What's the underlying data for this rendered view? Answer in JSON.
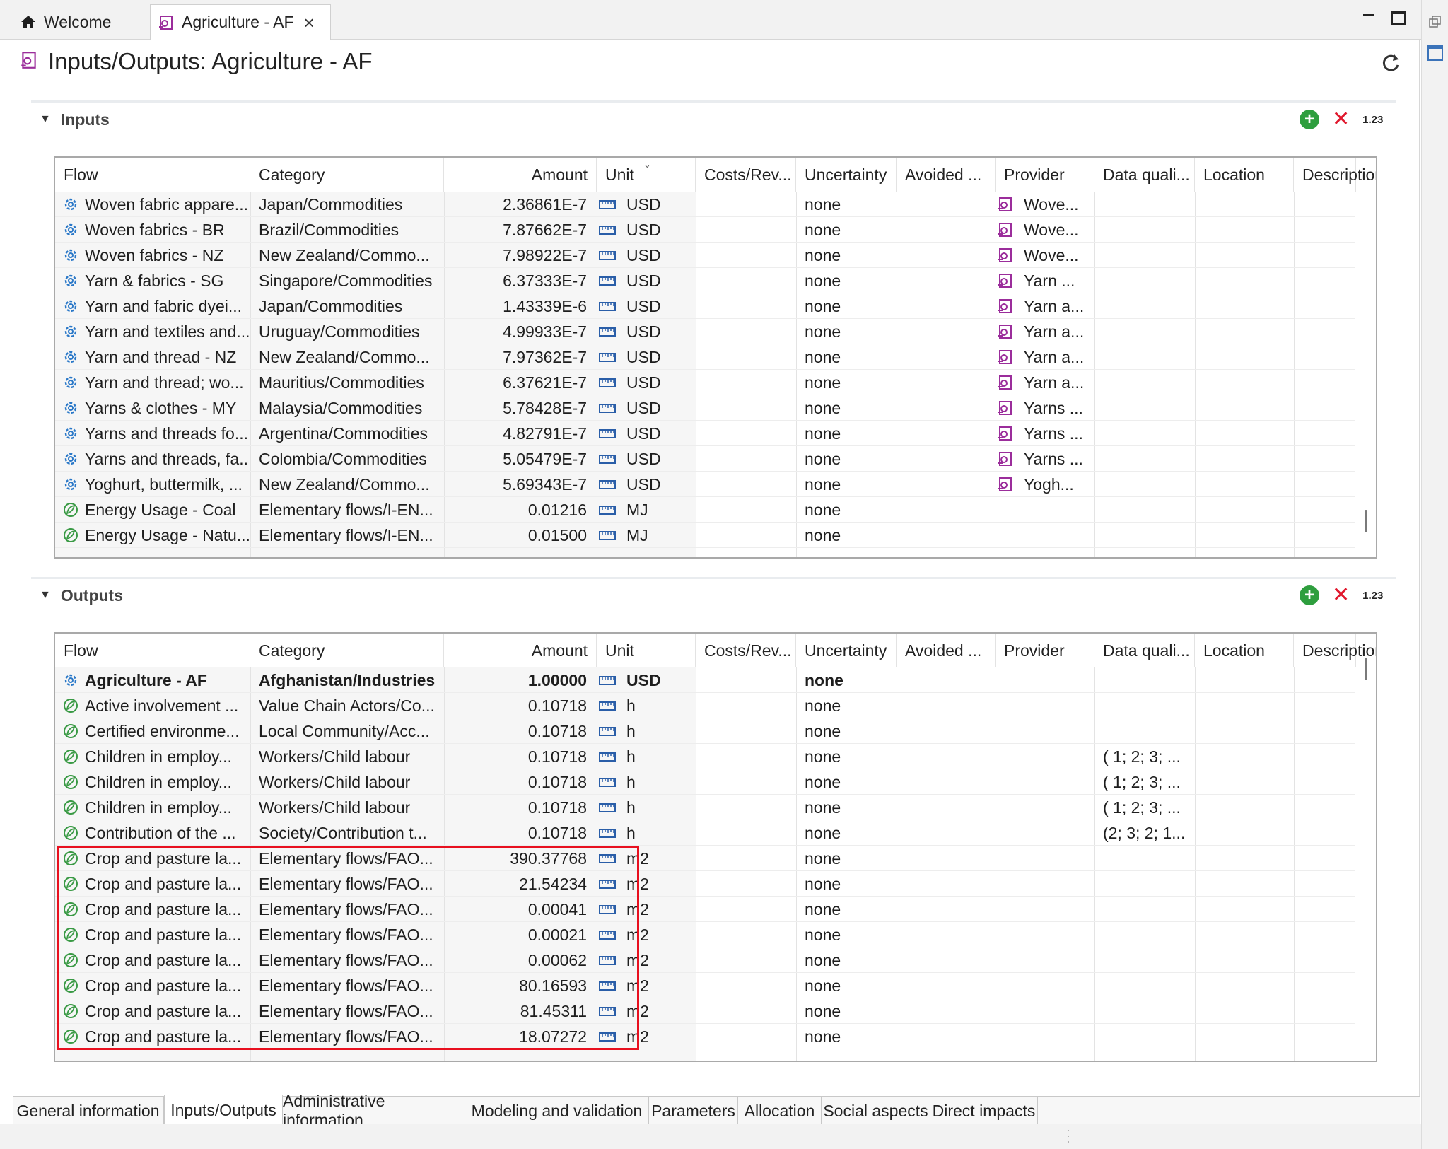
{
  "editor_tabs": [
    {
      "label": "Welcome",
      "icon": "home-icon"
    },
    {
      "label": "Agriculture - AF",
      "icon": "process-icon"
    }
  ],
  "page_title": "Inputs/Outputs: Agriculture - AF",
  "inputs": {
    "title": "Inputs",
    "tool_number_label": "1.23",
    "columns": [
      "Flow",
      "Category",
      "Amount",
      "Unit",
      "Costs/Rev...",
      "Uncertainty",
      "Avoided ...",
      "Provider",
      "Data quali...",
      "Location",
      "Description"
    ],
    "rows": [
      {
        "flow": "Woven fabric appare...",
        "flow_icon": "product-flow-icon",
        "category": "Japan/Commodities",
        "amount": "2.36861E-7",
        "unit": "USD",
        "uncertainty": "none",
        "provider": "Wove...",
        "data_quality": ""
      },
      {
        "flow": "Woven fabrics - BR",
        "flow_icon": "product-flow-icon",
        "category": "Brazil/Commodities",
        "amount": "7.87662E-7",
        "unit": "USD",
        "uncertainty": "none",
        "provider": "Wove...",
        "data_quality": ""
      },
      {
        "flow": "Woven fabrics - NZ",
        "flow_icon": "product-flow-icon",
        "category": "New Zealand/Commo...",
        "amount": "7.98922E-7",
        "unit": "USD",
        "uncertainty": "none",
        "provider": "Wove...",
        "data_quality": ""
      },
      {
        "flow": "Yarn & fabrics - SG",
        "flow_icon": "product-flow-icon",
        "category": "Singapore/Commodities",
        "amount": "6.37333E-7",
        "unit": "USD",
        "uncertainty": "none",
        "provider": "Yarn ...",
        "data_quality": ""
      },
      {
        "flow": "Yarn and fabric dyei...",
        "flow_icon": "product-flow-icon",
        "category": "Japan/Commodities",
        "amount": "1.43339E-6",
        "unit": "USD",
        "uncertainty": "none",
        "provider": "Yarn a...",
        "data_quality": ""
      },
      {
        "flow": "Yarn and textiles and...",
        "flow_icon": "product-flow-icon",
        "category": "Uruguay/Commodities",
        "amount": "4.99933E-7",
        "unit": "USD",
        "uncertainty": "none",
        "provider": "Yarn a...",
        "data_quality": ""
      },
      {
        "flow": "Yarn and thread - NZ",
        "flow_icon": "product-flow-icon",
        "category": "New Zealand/Commo...",
        "amount": "7.97362E-7",
        "unit": "USD",
        "uncertainty": "none",
        "provider": "Yarn a...",
        "data_quality": ""
      },
      {
        "flow": "Yarn and thread; wo...",
        "flow_icon": "product-flow-icon",
        "category": "Mauritius/Commodities",
        "amount": "6.37621E-7",
        "unit": "USD",
        "uncertainty": "none",
        "provider": "Yarn a...",
        "data_quality": ""
      },
      {
        "flow": "Yarns & clothes - MY",
        "flow_icon": "product-flow-icon",
        "category": "Malaysia/Commodities",
        "amount": "5.78428E-7",
        "unit": "USD",
        "uncertainty": "none",
        "provider": "Yarns ...",
        "data_quality": ""
      },
      {
        "flow": "Yarns and threads fo...",
        "flow_icon": "product-flow-icon",
        "category": "Argentina/Commodities",
        "amount": "4.82791E-7",
        "unit": "USD",
        "uncertainty": "none",
        "provider": "Yarns ...",
        "data_quality": ""
      },
      {
        "flow": "Yarns and threads, fa...",
        "flow_icon": "product-flow-icon",
        "category": "Colombia/Commodities",
        "amount": "5.05479E-7",
        "unit": "USD",
        "uncertainty": "none",
        "provider": "Yarns ...",
        "data_quality": ""
      },
      {
        "flow": "Yoghurt, buttermilk, ...",
        "flow_icon": "product-flow-icon",
        "category": "New Zealand/Commo...",
        "amount": "5.69343E-7",
        "unit": "USD",
        "uncertainty": "none",
        "provider": "Yogh...",
        "data_quality": ""
      },
      {
        "flow": "Energy Usage - Coal",
        "flow_icon": "elementary-flow-icon",
        "category": "Elementary flows/I-EN...",
        "amount": "0.01216",
        "unit": "MJ",
        "uncertainty": "none",
        "provider": "",
        "data_quality": ""
      },
      {
        "flow": "Energy Usage - Natu...",
        "flow_icon": "elementary-flow-icon",
        "category": "Elementary flows/I-EN...",
        "amount": "0.01500",
        "unit": "MJ",
        "uncertainty": "none",
        "provider": "",
        "data_quality": ""
      }
    ]
  },
  "outputs": {
    "title": "Outputs",
    "tool_number_label": "1.23",
    "columns": [
      "Flow",
      "Category",
      "Amount",
      "Unit",
      "Costs/Rev...",
      "Uncertainty",
      "Avoided ...",
      "Provider",
      "Data quali...",
      "Location",
      "Description"
    ],
    "rows": [
      {
        "flow": "Agriculture - AF",
        "flow_icon": "product-flow-icon",
        "category": "Afghanistan/Industries",
        "amount": "1.00000",
        "unit": "USD",
        "uncertainty": "none",
        "provider": "",
        "data_quality": "",
        "bold": true
      },
      {
        "flow": "Active involvement ...",
        "flow_icon": "elementary-flow-icon",
        "category": "Value Chain Actors/Co...",
        "amount": "0.10718",
        "unit": "h",
        "uncertainty": "none",
        "provider": "",
        "data_quality": ""
      },
      {
        "flow": "Certified environme...",
        "flow_icon": "elementary-flow-icon",
        "category": "Local Community/Acc...",
        "amount": "0.10718",
        "unit": "h",
        "uncertainty": "none",
        "provider": "",
        "data_quality": ""
      },
      {
        "flow": "Children in employ...",
        "flow_icon": "elementary-flow-icon",
        "category": "Workers/Child labour",
        "amount": "0.10718",
        "unit": "h",
        "uncertainty": "none",
        "provider": "",
        "data_quality": "( 1; 2; 3;  ..."
      },
      {
        "flow": "Children in employ...",
        "flow_icon": "elementary-flow-icon",
        "category": "Workers/Child labour",
        "amount": "0.10718",
        "unit": "h",
        "uncertainty": "none",
        "provider": "",
        "data_quality": "( 1; 2; 3;  ..."
      },
      {
        "flow": "Children in employ...",
        "flow_icon": "elementary-flow-icon",
        "category": "Workers/Child labour",
        "amount": "0.10718",
        "unit": "h",
        "uncertainty": "none",
        "provider": "",
        "data_quality": "( 1; 2; 3;  ..."
      },
      {
        "flow": "Contribution of the ...",
        "flow_icon": "elementary-flow-icon",
        "category": "Society/Contribution t...",
        "amount": "0.10718",
        "unit": "h",
        "uncertainty": "none",
        "provider": "",
        "data_quality": "(2; 3; 2;  1..."
      },
      {
        "flow": "Crop and pasture la...",
        "flow_icon": "elementary-flow-icon",
        "category": "Elementary flows/FAO...",
        "amount": "390.37768",
        "unit": "m2",
        "uncertainty": "none",
        "provider": "",
        "data_quality": ""
      },
      {
        "flow": "Crop and pasture la...",
        "flow_icon": "elementary-flow-icon",
        "category": "Elementary flows/FAO...",
        "amount": "21.54234",
        "unit": "m2",
        "uncertainty": "none",
        "provider": "",
        "data_quality": ""
      },
      {
        "flow": "Crop and pasture la...",
        "flow_icon": "elementary-flow-icon",
        "category": "Elementary flows/FAO...",
        "amount": "0.00041",
        "unit": "m2",
        "uncertainty": "none",
        "provider": "",
        "data_quality": ""
      },
      {
        "flow": "Crop and pasture la...",
        "flow_icon": "elementary-flow-icon",
        "category": "Elementary flows/FAO...",
        "amount": "0.00021",
        "unit": "m2",
        "uncertainty": "none",
        "provider": "",
        "data_quality": ""
      },
      {
        "flow": "Crop and pasture la...",
        "flow_icon": "elementary-flow-icon",
        "category": "Elementary flows/FAO...",
        "amount": "0.00062",
        "unit": "m2",
        "uncertainty": "none",
        "provider": "",
        "data_quality": ""
      },
      {
        "flow": "Crop and pasture la...",
        "flow_icon": "elementary-flow-icon",
        "category": "Elementary flows/FAO...",
        "amount": "80.16593",
        "unit": "m2",
        "uncertainty": "none",
        "provider": "",
        "data_quality": ""
      },
      {
        "flow": "Crop and pasture la...",
        "flow_icon": "elementary-flow-icon",
        "category": "Elementary flows/FAO...",
        "amount": "81.45311",
        "unit": "m2",
        "uncertainty": "none",
        "provider": "",
        "data_quality": ""
      },
      {
        "flow": "Crop and pasture la...",
        "flow_icon": "elementary-flow-icon",
        "category": "Elementary flows/FAO...",
        "amount": "18.07272",
        "unit": "m2",
        "uncertainty": "none",
        "provider": "",
        "data_quality": ""
      }
    ]
  },
  "bottom_tabs": [
    {
      "label": "General information",
      "active": false
    },
    {
      "label": "Inputs/Outputs",
      "active": true
    },
    {
      "label": "Administrative information",
      "active": false
    },
    {
      "label": "Modeling and validation",
      "active": false
    },
    {
      "label": "Parameters",
      "active": false
    },
    {
      "label": "Allocation",
      "active": false
    },
    {
      "label": "Social aspects",
      "active": false
    },
    {
      "label": "Direct impacts",
      "active": false
    }
  ],
  "colors": {
    "product_flow_icon": "#2a78c8",
    "elementary_flow_icon": "#3a9a45",
    "process_icon": "#9b2d9b",
    "add_button": "#2e9e3e",
    "delete_button": "#e0182d",
    "highlight_box": "#e8101f"
  }
}
